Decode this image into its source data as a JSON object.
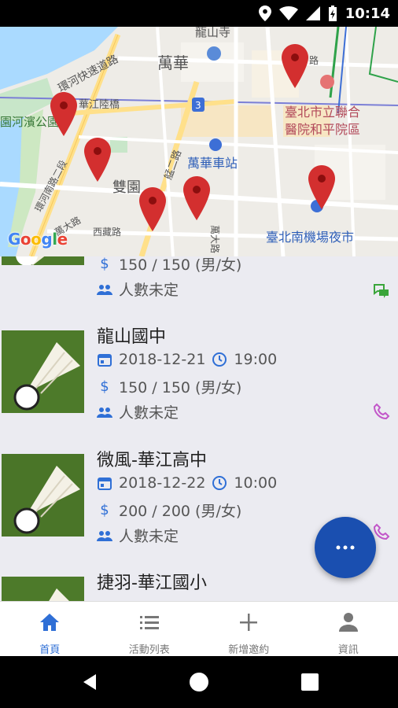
{
  "status_bar": {
    "time": "10:14",
    "icons": [
      "location-icon",
      "wifi-icon",
      "signal-icon",
      "battery-charging-icon"
    ]
  },
  "map": {
    "labels": {
      "longshan_temple": "龍山寺",
      "wanhua": "萬華",
      "huanhe_expressway": "環河快速道路",
      "huajiang_bridge": "華江陸橋",
      "riverside_park": "園河濱公園",
      "hospital": "臺北市立聯合\n醫院和平院區",
      "wanhua_station": "萬華車站",
      "shuangyuan": "雙園",
      "huanhe_south_rd": "環河南路二段",
      "wanda_rd": "萬大路",
      "xiyuan_rd": "西藏路",
      "jinjing_rd": "艋二路",
      "gaoda_rd": "萬大路",
      "nanjichang_market": "臺北南機場夜市",
      "road_shield": "3",
      "lu_suffix": "路"
    },
    "google_logo": "Google"
  },
  "events": [
    {
      "title": "",
      "date": "",
      "time": "",
      "price": "150 / 150 (男/女)",
      "people": "人數未定",
      "action": "chat-icon"
    },
    {
      "title": "龍山國中",
      "date": "2018-12-21",
      "time": "19:00",
      "price": "150 / 150 (男/女)",
      "people": "人數未定",
      "action": "phone-icon"
    },
    {
      "title": "微風-華江高中",
      "date": "2018-12-22",
      "time": "10:00",
      "price": "200 / 200 (男/女)",
      "people": "人數未定",
      "action": "phone-icon"
    },
    {
      "title": "捷羽-華江國小",
      "date": "",
      "time": "",
      "price": "",
      "people": "",
      "action": ""
    }
  ],
  "fab": {
    "icon": "more-horiz-icon"
  },
  "bottom_nav": {
    "items": [
      {
        "label": "首頁",
        "icon": "home-icon",
        "active": true
      },
      {
        "label": "活動列表",
        "icon": "list-icon",
        "active": false
      },
      {
        "label": "新增邀約",
        "icon": "plus-icon",
        "active": false
      },
      {
        "label": "資訊",
        "icon": "person-icon",
        "active": false
      }
    ]
  },
  "colors": {
    "accent": "#2f6fd6",
    "fab": "#1a4fb0",
    "pin": "#d32f2f",
    "chat": "#3aa53a",
    "phone": "#c257c9"
  }
}
